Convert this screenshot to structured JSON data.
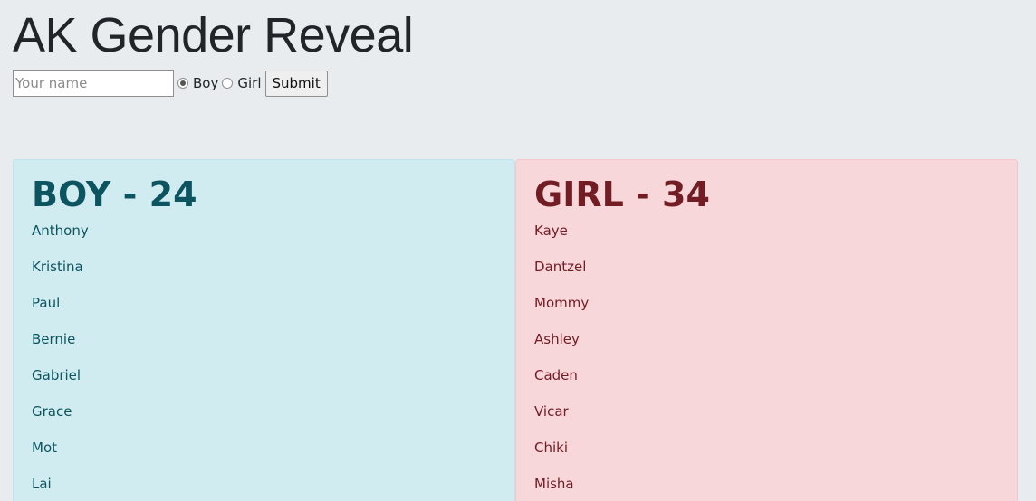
{
  "page": {
    "title": "AK Gender Reveal"
  },
  "form": {
    "name_placeholder": "Your name",
    "option_boy": "Boy",
    "option_girl": "Girl",
    "selected": "Boy",
    "submit_label": "Submit"
  },
  "boy": {
    "heading": "BOY - 24",
    "names": [
      "Anthony",
      "Kristina",
      "Paul",
      "Bernie",
      "Gabriel",
      "Grace",
      "Mot",
      "Lai"
    ]
  },
  "girl": {
    "heading": "GIRL - 34",
    "names": [
      "Kaye",
      "Dantzel",
      "Mommy",
      "Ashley",
      "Caden",
      "Vicar",
      "Chiki",
      "Misha"
    ]
  },
  "colors": {
    "background": "#e9ecef",
    "boy_panel": "#d1ecf1",
    "boy_text": "#0c5460",
    "girl_panel": "#f8d7da",
    "girl_text": "#721c24"
  }
}
